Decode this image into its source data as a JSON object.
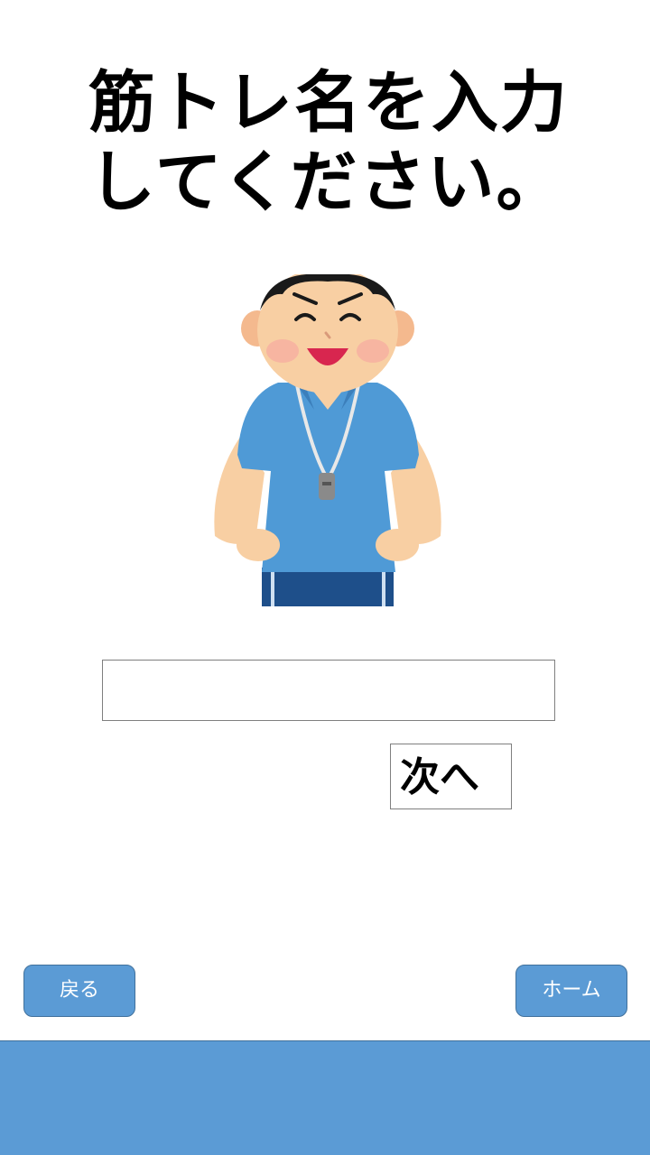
{
  "title": "筋トレ名を入力してください。",
  "illustration": {
    "icon": "trainer-with-whistle-icon",
    "colors": {
      "shirt": "#4f9ad6",
      "skin": "#f8cfa3",
      "hair": "#1a1a1a",
      "pants": "#1e4f8a",
      "mouth": "#d8264f"
    }
  },
  "name_input": {
    "value": "",
    "placeholder": ""
  },
  "next_button": {
    "label": "次へ"
  },
  "back_button": {
    "label": "戻る"
  },
  "home_button": {
    "label": "ホーム"
  },
  "colors": {
    "accent": "#5b9bd5",
    "accent_border": "#41719c"
  }
}
